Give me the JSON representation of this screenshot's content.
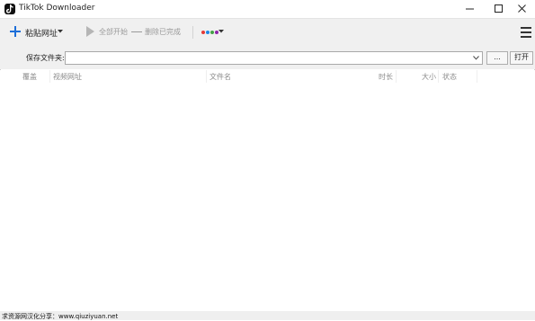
{
  "window": {
    "title": "TikTok Downloader"
  },
  "toolbar": {
    "paste_label": "粘贴网址",
    "start_all_label": "全部开始",
    "remove_done_label": "删除已完成",
    "colors": [
      "#e53935",
      "#1e88e5",
      "#43a047",
      "#8e24aa"
    ]
  },
  "save": {
    "label": "保存文件夹:",
    "folder_value": "",
    "browse_label": "...",
    "open_label": "打开"
  },
  "table": {
    "columns": [
      "覆盖",
      "视频网址",
      "文件名",
      "时长",
      "大小",
      "状态"
    ],
    "rows": []
  },
  "footer": {
    "text": "求资源网汉化分享：www.qiuziyuan.net"
  }
}
